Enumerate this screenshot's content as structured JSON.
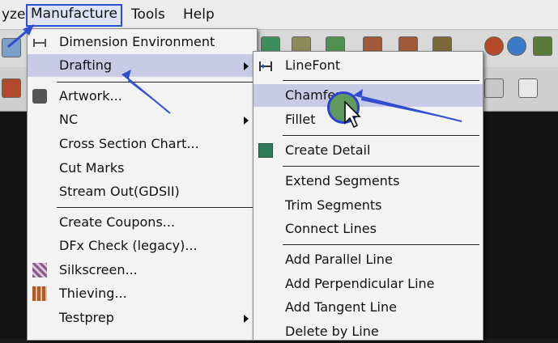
{
  "menubar": {
    "items": [
      {
        "label": "yze"
      },
      {
        "label": "Manufacture"
      },
      {
        "label": "Tools"
      },
      {
        "label": "Help"
      }
    ]
  },
  "manufacture_menu": {
    "items": [
      {
        "label": "Dimension Environment",
        "icon": "dimension-icon"
      },
      {
        "label": "Drafting",
        "submenu": true
      },
      {
        "label": "Artwork...",
        "icon": "artwork-icon"
      },
      {
        "label": "NC",
        "submenu": true
      },
      {
        "label": "Cross Section Chart..."
      },
      {
        "label": "Cut Marks"
      },
      {
        "label": "Stream Out(GDSII)"
      },
      {
        "label": "Create Coupons..."
      },
      {
        "label": "DFx Check (legacy)..."
      },
      {
        "label": "Silkscreen...",
        "icon": "silkscreen-icon"
      },
      {
        "label": "Thieving...",
        "icon": "thieving-icon"
      },
      {
        "label": "Testprep",
        "submenu": true
      }
    ]
  },
  "drafting_menu": {
    "items": [
      {
        "label": "LineFont",
        "icon": "linefont-icon"
      },
      {
        "label": "Chamfer"
      },
      {
        "label": "Fillet"
      },
      {
        "label": "Create Detail",
        "icon": "create-detail-icon"
      },
      {
        "label": "Extend Segments"
      },
      {
        "label": "Trim Segments"
      },
      {
        "label": "Connect Lines"
      },
      {
        "label": "Add Parallel Line"
      },
      {
        "label": "Add Perpendicular Line"
      },
      {
        "label": "Add Tangent Line"
      },
      {
        "label": "Delete by Line"
      }
    ]
  },
  "colors": {
    "highlight": "#c9cbe6",
    "annotation_arrow": "#2f4fd0",
    "menu_bg": "#f3f3f3"
  }
}
